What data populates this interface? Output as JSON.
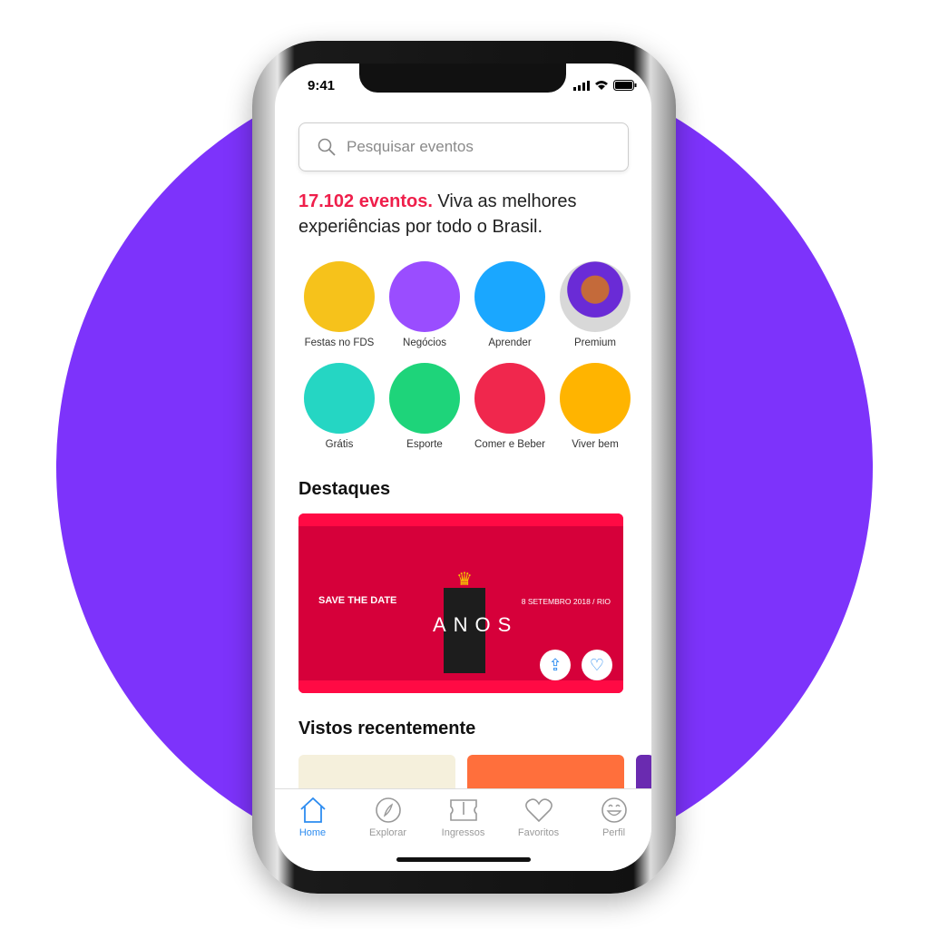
{
  "status_bar": {
    "time": "9:41"
  },
  "search": {
    "placeholder": "Pesquisar eventos"
  },
  "headline": {
    "count": "17.102 eventos.",
    "text": " Viva as melhores experiências por todo o Brasil."
  },
  "categories": [
    {
      "label": "Festas no FDS",
      "color": "#f6c21b"
    },
    {
      "label": "Negócios",
      "color": "#9a4dff"
    },
    {
      "label": "Aprender",
      "color": "#1aa7ff"
    },
    {
      "label": "Premium",
      "color": "#d8d8d8"
    },
    {
      "label": "Grátis",
      "color": "#25d6c3"
    },
    {
      "label": "Esporte",
      "color": "#1ed47a"
    },
    {
      "label": "Comer e Beber",
      "color": "#f0274d"
    },
    {
      "label": "Viver bem",
      "color": "#ffb400"
    }
  ],
  "highlights": {
    "title": "Destaques",
    "banner": {
      "left_text": "SAVE THE DATE",
      "center_text": "ANOS",
      "right_text": "8 SETEMBRO 2018 / RIO"
    }
  },
  "recent": {
    "title": "Vistos recentemente",
    "cards": [
      {
        "color": "#f5f0dc"
      },
      {
        "color": "#ff6f3c"
      }
    ]
  },
  "tabs": [
    {
      "label": "Home",
      "active": true
    },
    {
      "label": "Explorar"
    },
    {
      "label": "Ingressos"
    },
    {
      "label": "Favoritos"
    },
    {
      "label": "Perfil"
    }
  ],
  "colors": {
    "accent": "#ef1f4b",
    "tab_active": "#2d8cf0",
    "background_circle": "#7d33fb"
  }
}
